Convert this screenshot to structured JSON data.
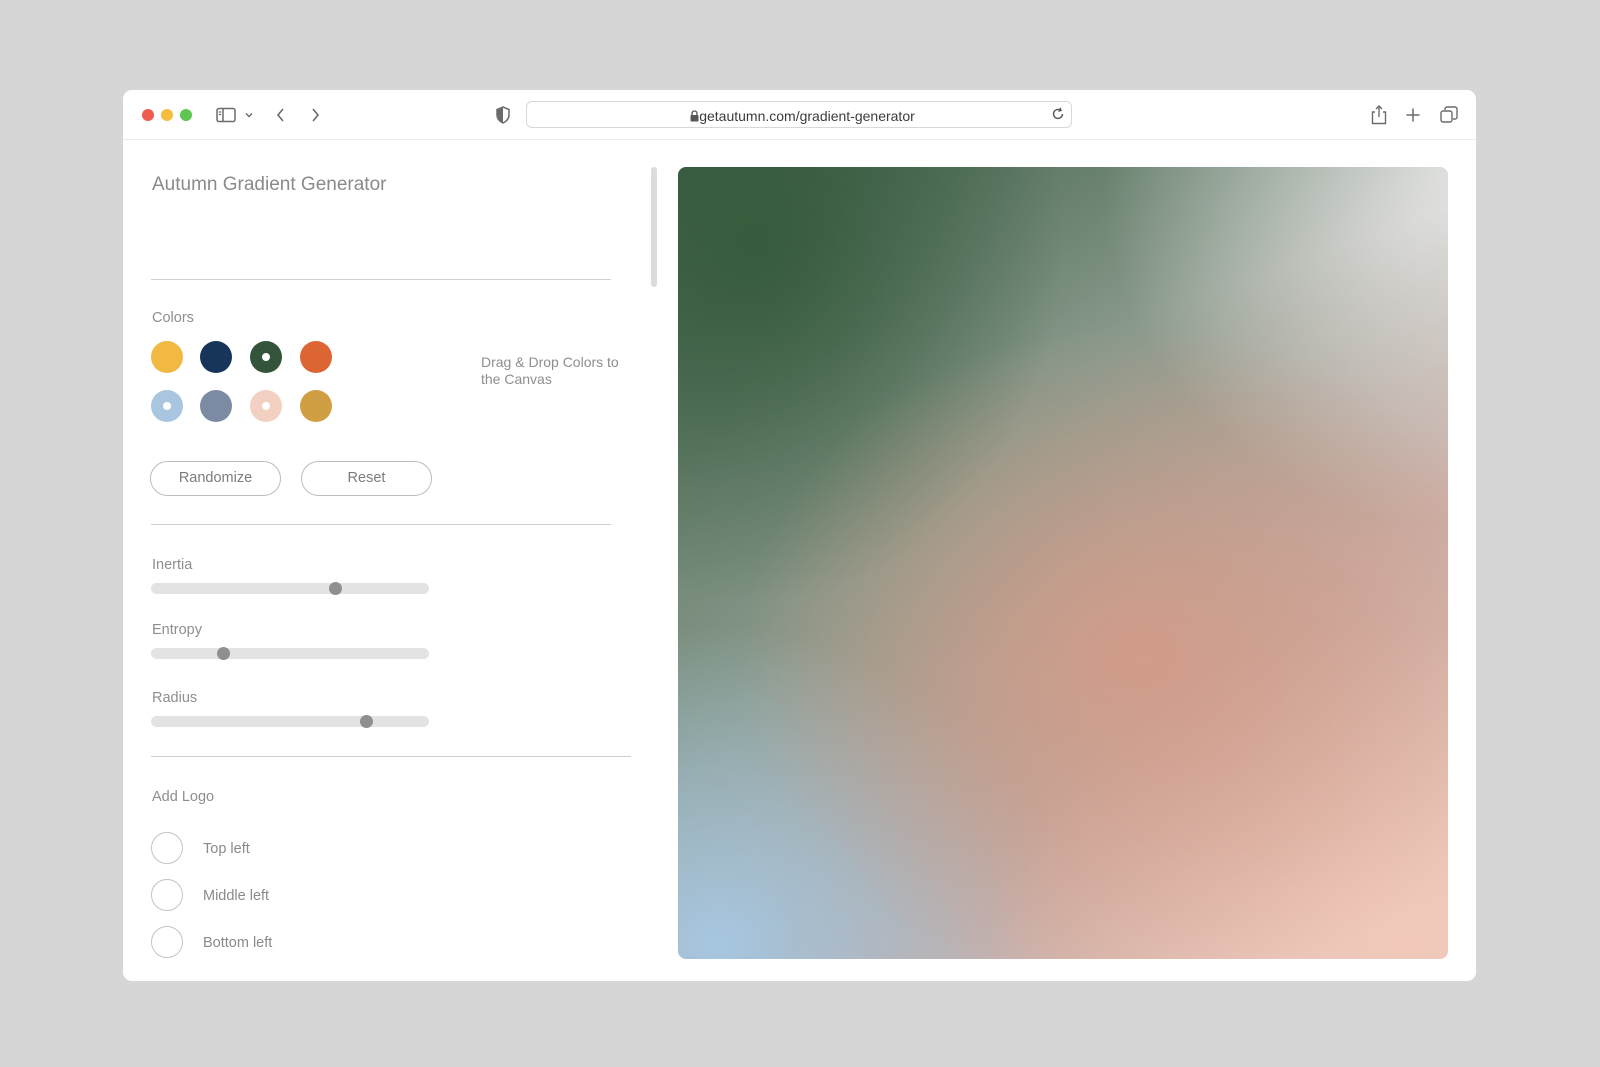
{
  "browser": {
    "url": "getautumn.com/gradient-generator"
  },
  "app": {
    "title": "Autumn Gradient Generator"
  },
  "colors": {
    "label": "Colors",
    "hint": "Drag & Drop Colors to the Canvas",
    "swatches": [
      {
        "name": "yellow",
        "hex": "#f1b941",
        "selected": false
      },
      {
        "name": "navy",
        "hex": "#17355b",
        "selected": false
      },
      {
        "name": "dark-green",
        "hex": "#33543a",
        "selected": true
      },
      {
        "name": "orange",
        "hex": "#dd6533",
        "selected": false
      },
      {
        "name": "light-blue",
        "hex": "#a8c6e0",
        "selected": true
      },
      {
        "name": "slate",
        "hex": "#7c8ba3",
        "selected": false
      },
      {
        "name": "peach",
        "hex": "#f2d0c2",
        "selected": true
      },
      {
        "name": "gold",
        "hex": "#d19f43",
        "selected": false
      }
    ]
  },
  "buttons": {
    "randomize": "Randomize",
    "reset": "Reset"
  },
  "sliders": [
    {
      "label": "Inertia",
      "value": 0.67
    },
    {
      "label": "Entropy",
      "value": 0.25
    },
    {
      "label": "Radius",
      "value": 0.79
    }
  ],
  "logo": {
    "label": "Add Logo",
    "options": [
      "Top left",
      "Middle left",
      "Bottom left"
    ]
  }
}
